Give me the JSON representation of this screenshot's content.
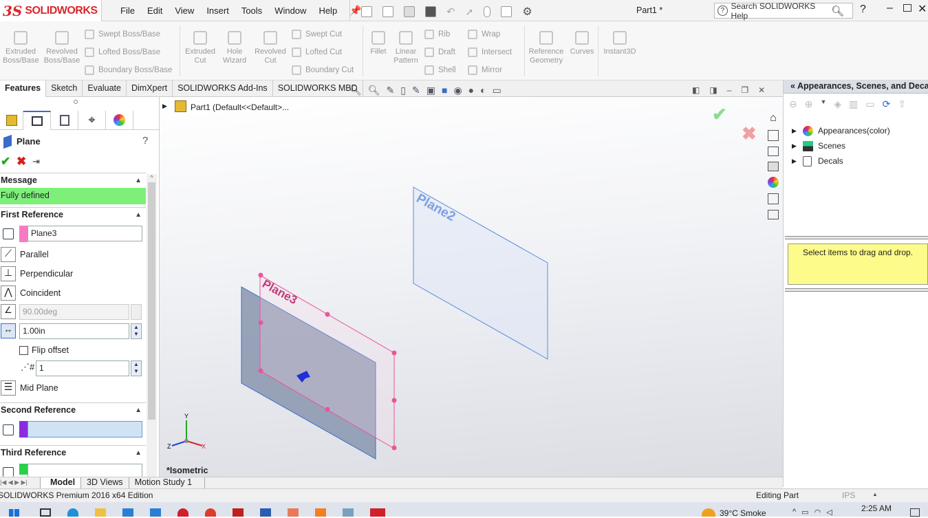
{
  "app": {
    "brand": "SOLIDWORKS",
    "doc_title": "Part1 *",
    "search_placeholder": "Search SOLIDWORKS Help"
  },
  "menu": [
    "File",
    "Edit",
    "View",
    "Insert",
    "Tools",
    "Window",
    "Help"
  ],
  "ribbon": {
    "big": [
      {
        "label1": "Extruded",
        "label2": "Boss/Base"
      },
      {
        "label1": "Revolved",
        "label2": "Boss/Base"
      },
      {
        "label1": "Extruded",
        "label2": "Cut"
      },
      {
        "label1": "Hole",
        "label2": "Wizard"
      },
      {
        "label1": "Revolved",
        "label2": "Cut"
      },
      {
        "label1": "Fillet",
        "label2": ""
      },
      {
        "label1": "Linear",
        "label2": "Pattern"
      },
      {
        "label1": "Reference",
        "label2": "Geometry"
      },
      {
        "label1": "Curves",
        "label2": ""
      },
      {
        "label1": "Instant3D",
        "label2": ""
      }
    ],
    "small": [
      "Swept Boss/Base",
      "Lofted Boss/Base",
      "Boundary Boss/Base",
      "Swept Cut",
      "Lofted Cut",
      "Boundary Cut",
      "Rib",
      "Draft",
      "Shell",
      "Wrap",
      "Intersect",
      "Mirror"
    ]
  },
  "tabs": [
    "Features",
    "Sketch",
    "Evaluate",
    "DimXpert",
    "SOLIDWORKS Add-Ins",
    "SOLIDWORKS MBD"
  ],
  "property_manager": {
    "title": "Plane",
    "help": "?",
    "message_header": "Message",
    "message": "Fully defined",
    "first_ref_header": "First Reference",
    "first_ref_value": "Plane3",
    "options": [
      "Parallel",
      "Perpendicular",
      "Coincident"
    ],
    "angle_value": "90.00deg",
    "offset_value": "1.00in",
    "flip_offset": "Flip offset",
    "count_value": "1",
    "mid_plane": "Mid Plane",
    "second_ref_header": "Second Reference",
    "third_ref_header": "Third Reference"
  },
  "tree": {
    "part": "Part1  (Default<<Default>..."
  },
  "viewport": {
    "plane2_label": "Plane2",
    "plane3_label": "Plane3",
    "view_name": "*Isometric",
    "axis_x": "X",
    "axis_y": "Y",
    "axis_z": "Z"
  },
  "task_pane": {
    "title": "Appearances, Scenes, and Decals",
    "items": [
      "Appearances(color)",
      "Scenes",
      "Decals"
    ],
    "drop_hint": "Select items to drag and drop."
  },
  "bottom_tabs": [
    "Model",
    "3D Views",
    "Motion Study 1"
  ],
  "status": {
    "edition": "SOLIDWORKS Premium 2016 x64 Edition",
    "mode": "Editing Part",
    "units": "IPS"
  },
  "taskbar": {
    "weather": "39°C  Smoke",
    "time": "2:25 AM"
  },
  "colors": {
    "brand": "#d9262c",
    "message_bg": "#7ef07a",
    "plane3": "#e8559c",
    "plane2": "#5a8ddd",
    "hint_bg": "#fdfc8a"
  }
}
